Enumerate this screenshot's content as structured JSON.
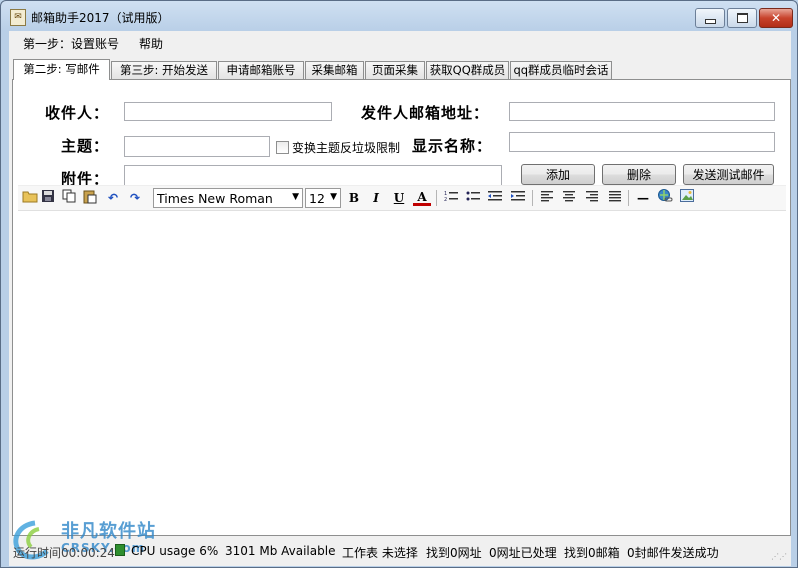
{
  "window": {
    "title": "邮箱助手2017（试用版）",
    "icon_name": "app-mailbox-icon",
    "minimize_glyph": "▭",
    "maximize_glyph": "◻",
    "close_glyph": "✕"
  },
  "menu": {
    "items": [
      "第一步：设置账号",
      "帮助"
    ]
  },
  "tabs": [
    {
      "label": "第二步: 写邮件",
      "active": true
    },
    {
      "label": "第三步: 开始发送",
      "active": false
    },
    {
      "label": "申请邮箱账号",
      "active": false
    },
    {
      "label": "采集邮箱",
      "active": false
    },
    {
      "label": "页面采集",
      "active": false
    },
    {
      "label": "获取QQ群成员",
      "active": false
    },
    {
      "label": "qq群成员临时会话",
      "active": false
    }
  ],
  "form": {
    "recipient_label": "收件人：",
    "recipient_value": "",
    "sender_label": "发件人邮箱地址：",
    "sender_value": "",
    "subject_label": "主题：",
    "subject_value": "",
    "antispam_label": "变换主题反垃圾限制",
    "antispam_checked": false,
    "display_name_label": "显示名称：",
    "display_name_value": "",
    "attachment_label": "附件：",
    "attachment_value": "",
    "add_button": "添加",
    "delete_button": "删除",
    "test_send_button": "发送测试邮件"
  },
  "toolbar": {
    "font_family": "Times New Roman",
    "font_size": "12",
    "bold": "B",
    "italic": "I",
    "underline": "U",
    "font_color": "A",
    "hr_glyph": "—"
  },
  "status": {
    "runtime": "运行时间00:00:24",
    "cpu": "CPU usage 6%",
    "memory": "3101 Mb Available",
    "worksheet": "工作表 未选择",
    "urls_found": "找到0网址",
    "urls_processed": "0网址已处理",
    "emails_found": "找到0邮箱",
    "sent": "0封邮件发送成功"
  },
  "watermark": {
    "line1": "非凡软件站",
    "line2": "CRSKY.com"
  },
  "colors": {
    "accent": "#2f87c9",
    "close_button": "#c8432c",
    "font_color_underline": "#c00000"
  }
}
